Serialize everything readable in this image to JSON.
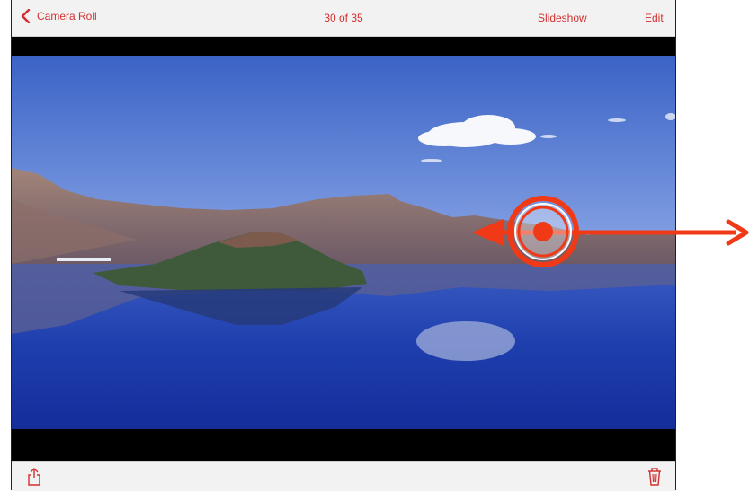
{
  "navbar": {
    "back_label": "Camera Roll",
    "title": "30 of 35",
    "slideshow_label": "Slideshow",
    "edit_label": "Edit"
  },
  "photo": {
    "description_icon": "landscape-photo"
  },
  "toolbar": {
    "share_icon": "share-icon",
    "trash_icon": "trash-icon"
  },
  "gesture": {
    "type": "swipe",
    "direction": "horizontal"
  },
  "colors": {
    "accent": "#d32f2f",
    "bar_background": "#f2f2f2",
    "gesture": "#f03a17"
  }
}
